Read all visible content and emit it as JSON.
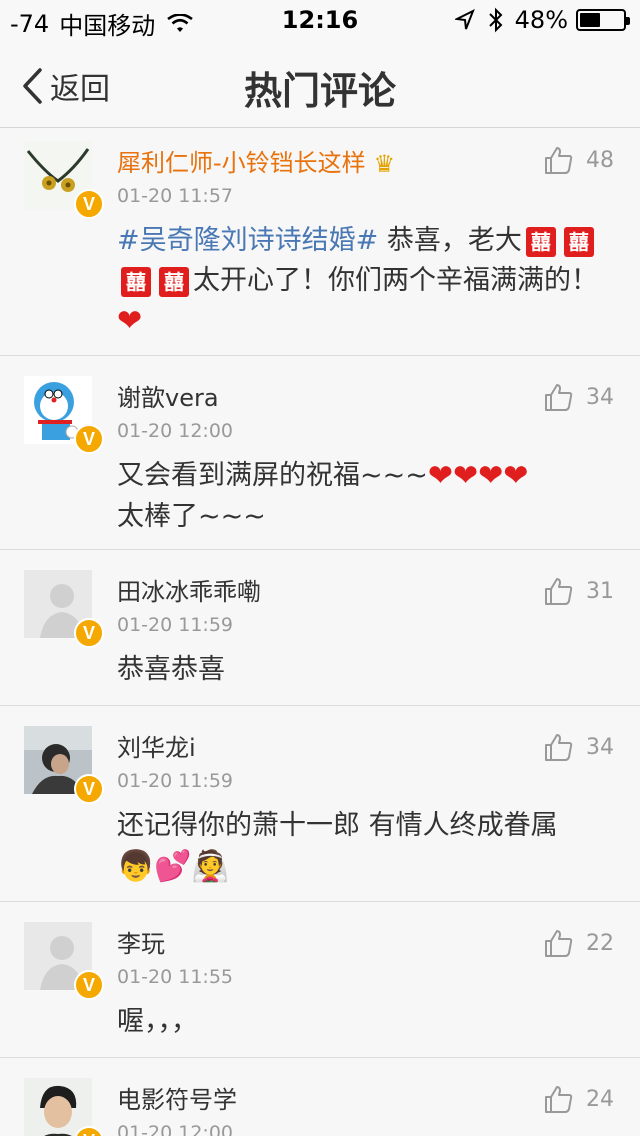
{
  "status_bar": {
    "signal": "-74",
    "carrier": "中国移动",
    "time": "12:16",
    "battery_pct": "48%",
    "battery_level": 0.48
  },
  "nav": {
    "back_label": "返回",
    "title": "热门评论"
  },
  "comments": [
    {
      "name": "犀利仁师-小铃铛长这样",
      "time": "01-20 11:57",
      "likes": "48",
      "text_tag": "#吴奇隆刘诗诗结婚#",
      "text_a": " 恭喜，老大",
      "text_b": "太开心了！你们两个辛福满满的！"
    },
    {
      "name": "谢歆vera",
      "time": "01-20 12:00",
      "likes": "34",
      "text_a": "又会看到满屏的祝福~~~",
      "text_b": "太棒了~~~"
    },
    {
      "name": "田冰冰乖乖嘞",
      "time": "01-20 11:59",
      "likes": "31",
      "text_a": "恭喜恭喜"
    },
    {
      "name": "刘华龙i",
      "time": "01-20 11:59",
      "likes": "34",
      "text_a": "还记得你的萧十一郎 有情人终成眷属"
    },
    {
      "name": "李玩",
      "time": "01-20 11:55",
      "likes": "22",
      "text_a": "喔，，，"
    },
    {
      "name": "电影符号学",
      "time": "01-20 12:00",
      "likes": "24"
    }
  ],
  "colors": {
    "vip_name": "#e8720c",
    "hashtag": "#4a78b4",
    "badge": "#f5a800",
    "heart": "#e01e1e"
  }
}
